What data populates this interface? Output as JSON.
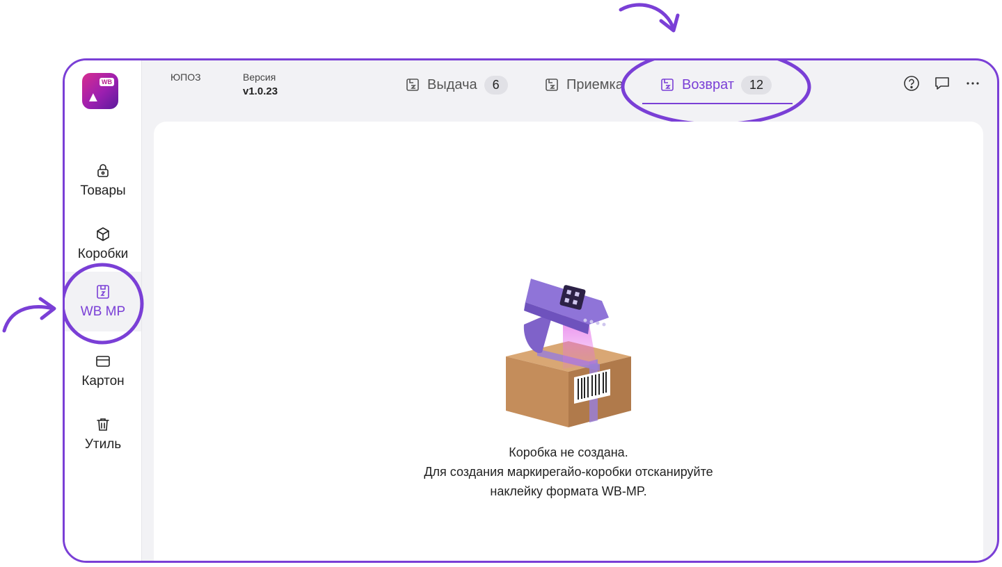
{
  "sidebar": {
    "items": [
      {
        "label": "Товары",
        "icon": "lock-icon"
      },
      {
        "label": "Коробки",
        "icon": "box-icon"
      },
      {
        "label": "WB MP",
        "icon": "wb-mp-icon",
        "active": true
      },
      {
        "label": "Картон",
        "icon": "carton-icon"
      },
      {
        "label": "Утиль",
        "icon": "trash-icon"
      }
    ]
  },
  "header": {
    "store_name": "ЮПОЗ",
    "version_label": "Версия",
    "version_value": "v1.0.23",
    "tabs": [
      {
        "label": "Выдача",
        "badge": "6"
      },
      {
        "label": "Приемка"
      },
      {
        "label": "Возврат",
        "badge": "12",
        "active": true
      }
    ],
    "actions": [
      "help-icon",
      "chat-icon",
      "more-icon"
    ]
  },
  "empty_state": {
    "line1": "Коробка не создана.",
    "line2": "Для создания маркирегайо-коробки отсканируйте",
    "line3": "наклейку формата WB-MP."
  },
  "colors": {
    "accent": "#7a3fd6",
    "background": "#f2f2f5",
    "surface": "#ffffff"
  }
}
